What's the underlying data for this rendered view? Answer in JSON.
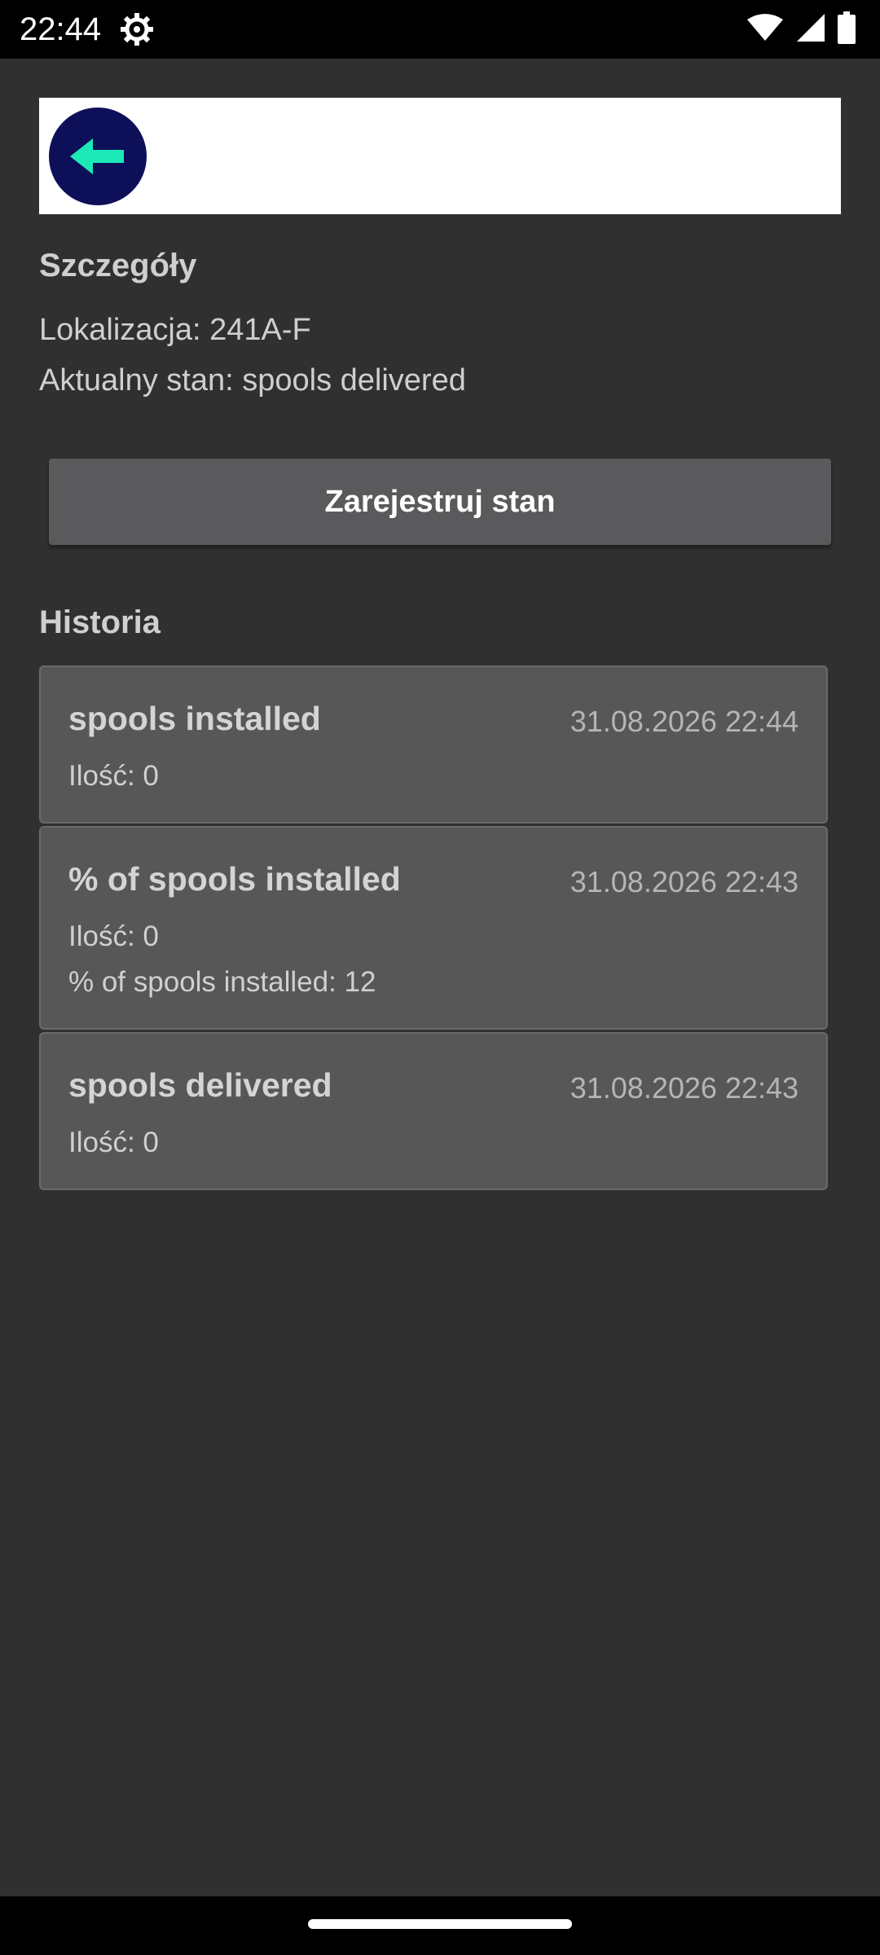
{
  "status_bar": {
    "time": "22:44",
    "icons": [
      "gear-icon",
      "wifi-icon",
      "signal-icon",
      "battery-icon"
    ]
  },
  "header": {
    "back_icon": "arrow-left-icon",
    "colors": {
      "back_button_bg": "#0d1059",
      "arrow": "#1de9b6"
    }
  },
  "details": {
    "title": "Szczegóły",
    "location": "Lokalizacja: 241A-F",
    "current_state": "Aktualny stan: spools delivered"
  },
  "register_button": {
    "label": "Zarejestruj stan"
  },
  "history": {
    "title": "Historia",
    "items": [
      {
        "title": "spools installed",
        "date": "31.08.2026 22:44",
        "qty": "Ilość: 0"
      },
      {
        "title": "% of spools installed",
        "date": "31.08.2026 22:43",
        "qty": "Ilość: 0",
        "extra": "% of spools installed: 12"
      },
      {
        "title": "spools delivered",
        "date": "31.08.2026 22:43",
        "qty": "Ilość: 0"
      }
    ]
  }
}
